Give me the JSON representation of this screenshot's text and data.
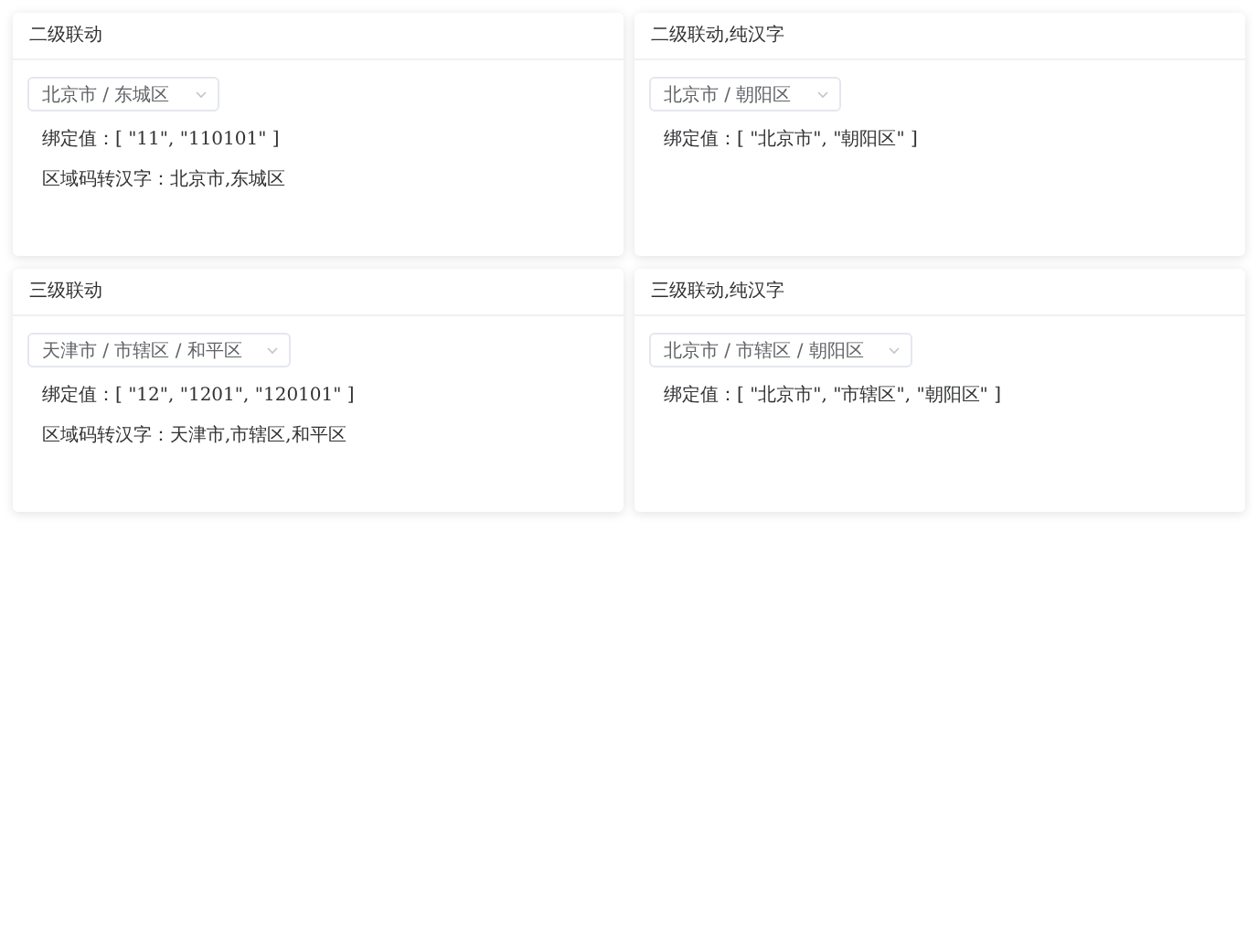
{
  "cards": [
    {
      "title": "二级联动",
      "select": "北京市 / 东城区",
      "lines": [
        "绑定值：[ \"11\", \"110101\" ]",
        "区域码转汉字：北京市,东城区"
      ]
    },
    {
      "title": "二级联动,纯汉字",
      "select": "北京市 / 朝阳区",
      "lines": [
        "绑定值：[ \"北京市\", \"朝阳区\" ]"
      ]
    },
    {
      "title": "三级联动",
      "select": "天津市 / 市辖区 / 和平区",
      "lines": [
        "绑定值：[ \"12\", \"1201\", \"120101\" ]",
        "区域码转汉字：天津市,市辖区,和平区"
      ]
    },
    {
      "title": "三级联动,纯汉字",
      "select": "北京市 / 市辖区 / 朝阳区",
      "lines": [
        "绑定值：[ \"北京市\", \"市辖区\", \"朝阳区\" ]"
      ]
    }
  ]
}
